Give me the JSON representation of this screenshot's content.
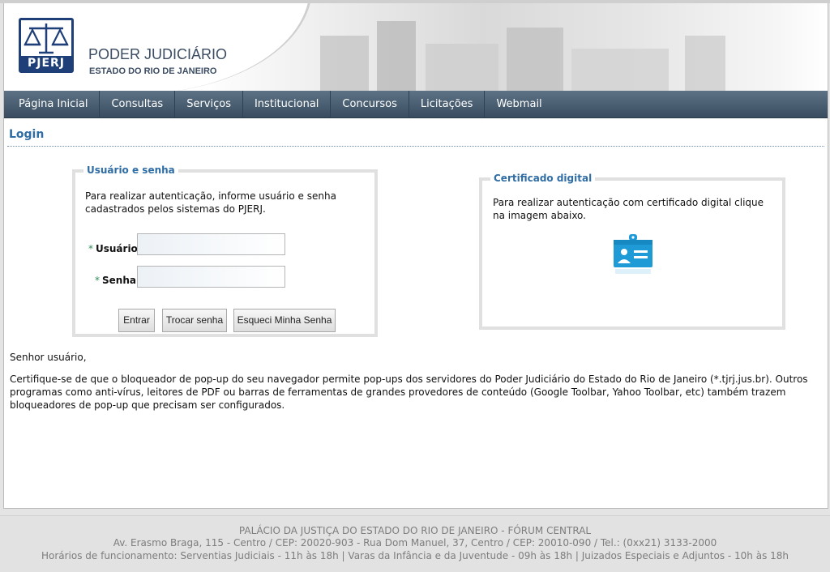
{
  "brand": {
    "logo_text": "PJERJ",
    "title": "PODER JUDICIÁRIO",
    "subtitle": "ESTADO DO RIO DE JANEIRO"
  },
  "nav": {
    "items": [
      {
        "label": "Página Inicial"
      },
      {
        "label": "Consultas"
      },
      {
        "label": "Serviços"
      },
      {
        "label": "Institucional"
      },
      {
        "label": "Concursos"
      },
      {
        "label": "Licitações"
      },
      {
        "label": "Webmail"
      }
    ]
  },
  "login": {
    "title": "Login",
    "user_panel": {
      "legend": "Usuário e senha",
      "description": "Para realizar autenticação, informe usuário e senha cadastrados pelos sistemas do PJERJ.",
      "required_mark": "*",
      "username_label": "Usuário:",
      "username_value": "",
      "password_label": "Senha:",
      "password_value": "",
      "buttons": {
        "enter": "Entrar",
        "change_password": "Trocar senha",
        "forgot_password": "Esqueci Minha Senha"
      }
    },
    "cert_panel": {
      "legend": "Certificado digital",
      "description": "Para realizar autenticação com certificado digital clique na imagem abaixo.",
      "icon": "id-card-icon",
      "icon_color": "#1e9bd7"
    }
  },
  "notice": {
    "greeting": "Senhor usuário,",
    "body": "Certifique-se de que o bloqueador de pop-up do seu navegador permite pop-ups dos servidores do Poder Judiciário do Estado do Rio de Janeiro (*.tjrj.jus.br). Outros programas como anti-vírus, leitores de PDF ou barras de ferramentas de grandes provedores de conteúdo (Google Toolbar, Yahoo Toolbar, etc) também trazem bloqueadores de pop-up que precisam ser configurados."
  },
  "footer": {
    "line1": "PALÁCIO DA JUSTIÇA DO ESTADO DO RIO DE JANEIRO - FÓRUM CENTRAL",
    "line2": "Av. Erasmo Braga, 115 - Centro / CEP: 20020-903 - Rua Dom Manuel, 37, Centro / CEP: 20010-090 / Tel.: (0xx21) 3133-2000",
    "line3": "Horários de funcionamento: Serventias Judiciais - 11h às 18h | Varas da Infância e da Juventude - 09h às 18h | Juizados Especiais e Adjuntos - 10h às 18h"
  },
  "colors": {
    "nav_background": "#4a5e72",
    "accent_blue": "#2f6da5",
    "logo_blue": "#1f3f78",
    "required_star": "#2e8b57"
  }
}
